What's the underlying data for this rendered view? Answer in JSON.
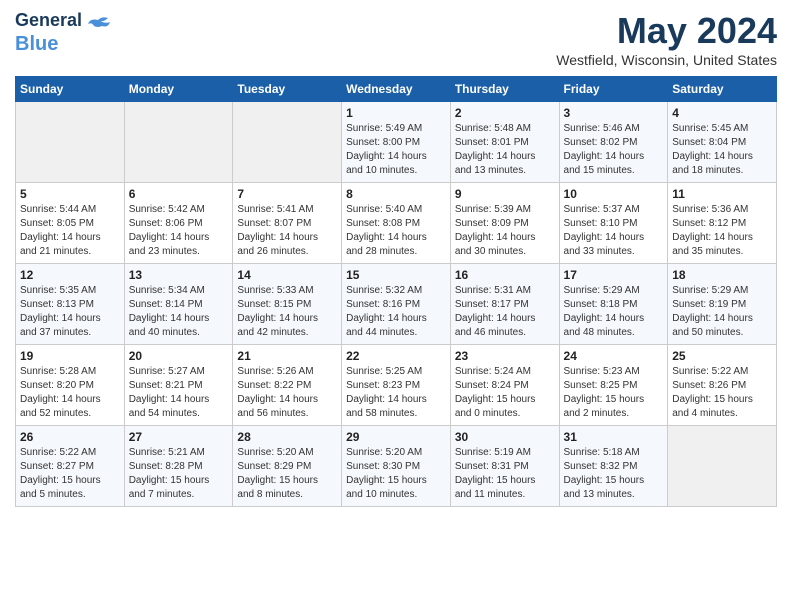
{
  "header": {
    "logo_line1": "General",
    "logo_line2": "Blue",
    "month_title": "May 2024",
    "location": "Westfield, Wisconsin, United States"
  },
  "weekdays": [
    "Sunday",
    "Monday",
    "Tuesday",
    "Wednesday",
    "Thursday",
    "Friday",
    "Saturday"
  ],
  "weeks": [
    [
      {
        "day": "",
        "info": ""
      },
      {
        "day": "",
        "info": ""
      },
      {
        "day": "",
        "info": ""
      },
      {
        "day": "1",
        "info": "Sunrise: 5:49 AM\nSunset: 8:00 PM\nDaylight: 14 hours\nand 10 minutes."
      },
      {
        "day": "2",
        "info": "Sunrise: 5:48 AM\nSunset: 8:01 PM\nDaylight: 14 hours\nand 13 minutes."
      },
      {
        "day": "3",
        "info": "Sunrise: 5:46 AM\nSunset: 8:02 PM\nDaylight: 14 hours\nand 15 minutes."
      },
      {
        "day": "4",
        "info": "Sunrise: 5:45 AM\nSunset: 8:04 PM\nDaylight: 14 hours\nand 18 minutes."
      }
    ],
    [
      {
        "day": "5",
        "info": "Sunrise: 5:44 AM\nSunset: 8:05 PM\nDaylight: 14 hours\nand 21 minutes."
      },
      {
        "day": "6",
        "info": "Sunrise: 5:42 AM\nSunset: 8:06 PM\nDaylight: 14 hours\nand 23 minutes."
      },
      {
        "day": "7",
        "info": "Sunrise: 5:41 AM\nSunset: 8:07 PM\nDaylight: 14 hours\nand 26 minutes."
      },
      {
        "day": "8",
        "info": "Sunrise: 5:40 AM\nSunset: 8:08 PM\nDaylight: 14 hours\nand 28 minutes."
      },
      {
        "day": "9",
        "info": "Sunrise: 5:39 AM\nSunset: 8:09 PM\nDaylight: 14 hours\nand 30 minutes."
      },
      {
        "day": "10",
        "info": "Sunrise: 5:37 AM\nSunset: 8:10 PM\nDaylight: 14 hours\nand 33 minutes."
      },
      {
        "day": "11",
        "info": "Sunrise: 5:36 AM\nSunset: 8:12 PM\nDaylight: 14 hours\nand 35 minutes."
      }
    ],
    [
      {
        "day": "12",
        "info": "Sunrise: 5:35 AM\nSunset: 8:13 PM\nDaylight: 14 hours\nand 37 minutes."
      },
      {
        "day": "13",
        "info": "Sunrise: 5:34 AM\nSunset: 8:14 PM\nDaylight: 14 hours\nand 40 minutes."
      },
      {
        "day": "14",
        "info": "Sunrise: 5:33 AM\nSunset: 8:15 PM\nDaylight: 14 hours\nand 42 minutes."
      },
      {
        "day": "15",
        "info": "Sunrise: 5:32 AM\nSunset: 8:16 PM\nDaylight: 14 hours\nand 44 minutes."
      },
      {
        "day": "16",
        "info": "Sunrise: 5:31 AM\nSunset: 8:17 PM\nDaylight: 14 hours\nand 46 minutes."
      },
      {
        "day": "17",
        "info": "Sunrise: 5:29 AM\nSunset: 8:18 PM\nDaylight: 14 hours\nand 48 minutes."
      },
      {
        "day": "18",
        "info": "Sunrise: 5:29 AM\nSunset: 8:19 PM\nDaylight: 14 hours\nand 50 minutes."
      }
    ],
    [
      {
        "day": "19",
        "info": "Sunrise: 5:28 AM\nSunset: 8:20 PM\nDaylight: 14 hours\nand 52 minutes."
      },
      {
        "day": "20",
        "info": "Sunrise: 5:27 AM\nSunset: 8:21 PM\nDaylight: 14 hours\nand 54 minutes."
      },
      {
        "day": "21",
        "info": "Sunrise: 5:26 AM\nSunset: 8:22 PM\nDaylight: 14 hours\nand 56 minutes."
      },
      {
        "day": "22",
        "info": "Sunrise: 5:25 AM\nSunset: 8:23 PM\nDaylight: 14 hours\nand 58 minutes."
      },
      {
        "day": "23",
        "info": "Sunrise: 5:24 AM\nSunset: 8:24 PM\nDaylight: 15 hours\nand 0 minutes."
      },
      {
        "day": "24",
        "info": "Sunrise: 5:23 AM\nSunset: 8:25 PM\nDaylight: 15 hours\nand 2 minutes."
      },
      {
        "day": "25",
        "info": "Sunrise: 5:22 AM\nSunset: 8:26 PM\nDaylight: 15 hours\nand 4 minutes."
      }
    ],
    [
      {
        "day": "26",
        "info": "Sunrise: 5:22 AM\nSunset: 8:27 PM\nDaylight: 15 hours\nand 5 minutes."
      },
      {
        "day": "27",
        "info": "Sunrise: 5:21 AM\nSunset: 8:28 PM\nDaylight: 15 hours\nand 7 minutes."
      },
      {
        "day": "28",
        "info": "Sunrise: 5:20 AM\nSunset: 8:29 PM\nDaylight: 15 hours\nand 8 minutes."
      },
      {
        "day": "29",
        "info": "Sunrise: 5:20 AM\nSunset: 8:30 PM\nDaylight: 15 hours\nand 10 minutes."
      },
      {
        "day": "30",
        "info": "Sunrise: 5:19 AM\nSunset: 8:31 PM\nDaylight: 15 hours\nand 11 minutes."
      },
      {
        "day": "31",
        "info": "Sunrise: 5:18 AM\nSunset: 8:32 PM\nDaylight: 15 hours\nand 13 minutes."
      },
      {
        "day": "",
        "info": ""
      }
    ]
  ]
}
